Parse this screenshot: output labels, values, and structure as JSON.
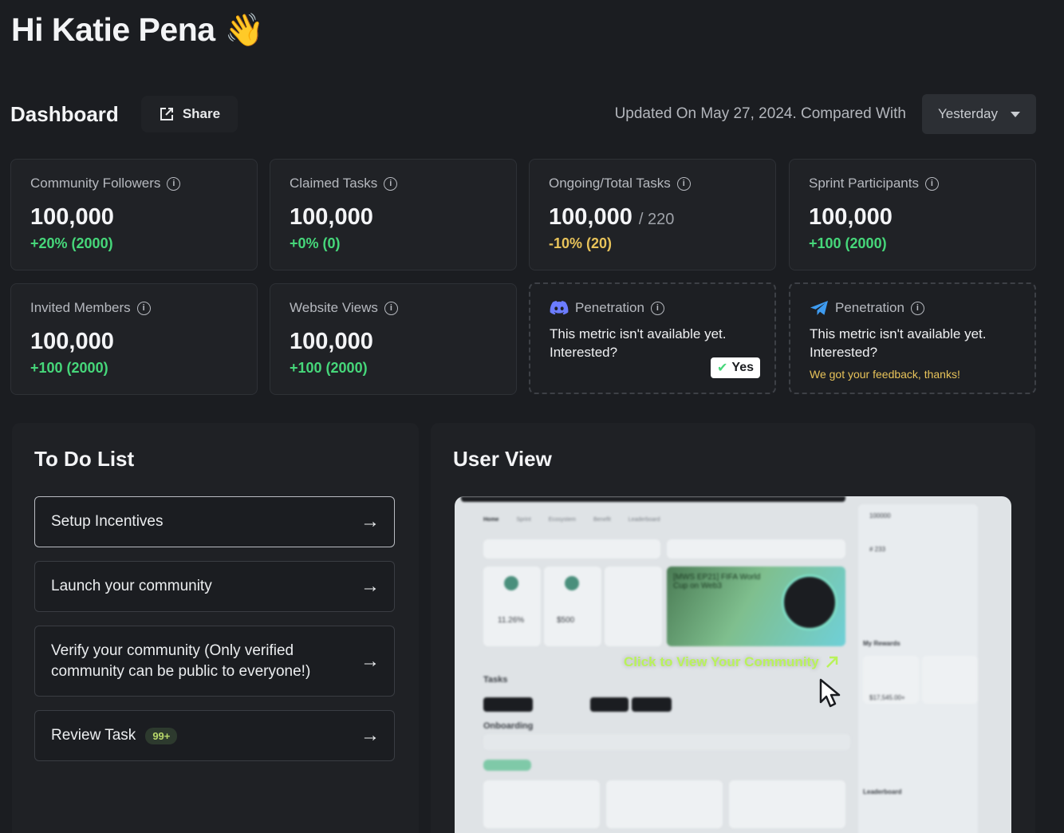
{
  "greeting": {
    "text": "Hi Katie Pena",
    "emoji": "👋"
  },
  "header": {
    "title": "Dashboard",
    "share_label": "Share",
    "updated_text": "Updated On May 27, 2024. Compared With",
    "period": "Yesterday"
  },
  "metrics": [
    {
      "label": "Community Followers",
      "value": "100,000",
      "delta": "+20% (2000)",
      "tone": "green"
    },
    {
      "label": "Claimed Tasks",
      "value": "100,000",
      "delta": "+0% (0)",
      "tone": "green"
    },
    {
      "label": "Ongoing/Total Tasks",
      "value": "100,000",
      "suffix": "/ 220",
      "delta": "-10% (20)",
      "tone": "yellow"
    },
    {
      "label": "Sprint Participants",
      "value": "100,000",
      "delta": "+100 (2000)",
      "tone": "green"
    },
    {
      "label": "Invited Members",
      "value": "100,000",
      "delta": "+100 (2000)",
      "tone": "green"
    },
    {
      "label": "Website Views",
      "value": "100,000",
      "delta": "+100 (2000)",
      "tone": "green"
    }
  ],
  "penetration_cards": [
    {
      "icon": "discord-icon",
      "label": "Penetration",
      "message": "This metric isn't available yet. Interested?",
      "action_label": "Yes"
    },
    {
      "icon": "telegram-icon",
      "label": "Penetration",
      "message": "This metric isn't available yet. Interested?",
      "feedback": "We got your feedback, thanks!"
    }
  ],
  "todo": {
    "title": "To Do List",
    "items": [
      {
        "label": "Setup Incentives"
      },
      {
        "label": "Launch your community"
      },
      {
        "label": "Verify your community (Only verified community can be public to everyone!)"
      },
      {
        "label": "Review Task",
        "badge": "99+"
      }
    ]
  },
  "user_view": {
    "title": "User View",
    "link_label": "Click to View Your Community",
    "preview": {
      "tabs": [
        "Home",
        "Sprint",
        "Ecosystem",
        "Benefit",
        "Leaderboard"
      ],
      "tasks_heading": "Tasks",
      "onboarding_heading": "Onboarding",
      "banner_title": "[MWS EP21] FIFA World Cup on Web3",
      "stat_1": "11.26%",
      "stat_2": "$500",
      "side_value_1": "100000",
      "side_value_2": "# 233",
      "rewards_heading": "My Rewards",
      "reward_value": "$17,545.00+",
      "leaderboard_heading": "Leaderboard"
    }
  },
  "colors": {
    "background": "#1b1d21",
    "card": "#202226",
    "positive": "#46d77a",
    "warning": "#e8c35a",
    "link": "#b9f25b"
  }
}
